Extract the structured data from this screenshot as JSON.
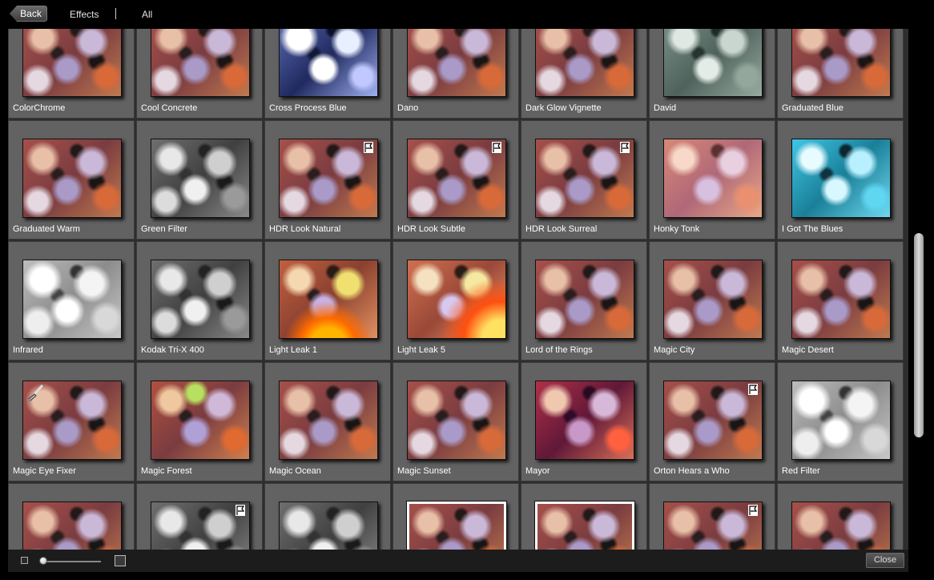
{
  "topbar": {
    "back_label": "Back",
    "crumb_effects": "Effects",
    "crumb_all": "All"
  },
  "grid": {
    "rows": [
      [
        {
          "label": "ColorChrome",
          "style": "warm",
          "flag": false
        },
        {
          "label": "Cool Concrete",
          "style": "warm",
          "flag": false
        },
        {
          "label": "Cross Process Blue",
          "style": "crossblue",
          "flag": false
        },
        {
          "label": "Dano",
          "style": "warm",
          "flag": false
        },
        {
          "label": "Dark Glow Vignette",
          "style": "warm",
          "flag": false
        },
        {
          "label": "David",
          "style": "teal",
          "flag": false
        },
        {
          "label": "Graduated Blue",
          "style": "warm",
          "flag": false
        }
      ],
      [
        {
          "label": "Graduated Warm",
          "style": "warm",
          "flag": false
        },
        {
          "label": "Green Filter",
          "style": "gray",
          "flag": false
        },
        {
          "label": "HDR Look Natural",
          "style": "warm",
          "flag": true
        },
        {
          "label": "HDR Look Subtle",
          "style": "warm",
          "flag": true
        },
        {
          "label": "HDR Look Surreal",
          "style": "warm",
          "flag": true
        },
        {
          "label": "Honky Tonk",
          "style": "honky",
          "flag": false
        },
        {
          "label": "I Got The Blues",
          "style": "blue",
          "flag": false
        }
      ],
      [
        {
          "label": "Infrared",
          "style": "lightgray",
          "flag": false
        },
        {
          "label": "Kodak Tri-X 400",
          "style": "gray",
          "flag": false
        },
        {
          "label": "Light Leak 1",
          "style": "leak",
          "flag": false
        },
        {
          "label": "Light Leak 5",
          "style": "leak5",
          "flag": false
        },
        {
          "label": "Lord of the Rings",
          "style": "warm",
          "flag": false
        },
        {
          "label": "Magic City",
          "style": "warm",
          "flag": false
        },
        {
          "label": "Magic Desert",
          "style": "warm",
          "flag": false
        }
      ],
      [
        {
          "label": "Magic Eye Fixer",
          "style": "warm",
          "flag": false,
          "brush": true
        },
        {
          "label": "Magic Forest",
          "style": "forest",
          "flag": false
        },
        {
          "label": "Magic Ocean",
          "style": "warm",
          "flag": false
        },
        {
          "label": "Magic Sunset",
          "style": "warm",
          "flag": false
        },
        {
          "label": "Mayor",
          "style": "purple",
          "flag": false
        },
        {
          "label": "Orton Hears a Who",
          "style": "warm",
          "flag": true
        },
        {
          "label": "Red Filter",
          "style": "lightgray",
          "flag": false
        }
      ],
      [
        {
          "label": "",
          "style": "warm",
          "flag": false
        },
        {
          "label": "",
          "style": "gray",
          "flag": true
        },
        {
          "label": "",
          "style": "gray",
          "flag": false
        },
        {
          "label": "",
          "style": "warm",
          "flag": false,
          "white_border": true
        },
        {
          "label": "",
          "style": "warm",
          "flag": false,
          "white_border": true
        },
        {
          "label": "",
          "style": "warm",
          "flag": true
        },
        {
          "label": "",
          "style": "warm",
          "flag": false
        }
      ]
    ]
  },
  "bottombar": {
    "close_label": "Close",
    "thumbnail_size_fraction": 0.0
  }
}
